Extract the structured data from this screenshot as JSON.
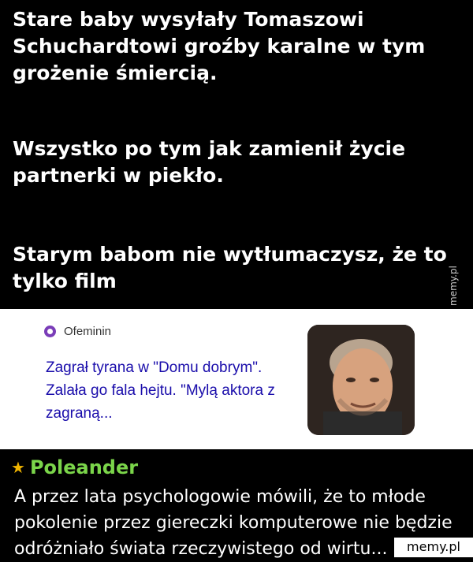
{
  "text_panel": {
    "paragraph_1": "Stare baby wysyłały Tomaszowi Schuchardtowi groźby karalne w tym grożenie śmiercią.",
    "paragraph_2": "Wszystko po tym jak zamienił życie partnerki w piekło.",
    "paragraph_3_line1": "Starym babom nie wytłumaczysz, że to",
    "paragraph_3_line2": "tylko film"
  },
  "article_card": {
    "source": "Ofeminin",
    "headline": "Zagrał tyrana w \"Domu dobrym\". Zalała go fala hejtu. \"Mylą aktora z zagraną...",
    "thumbnail_icon": "actor-portrait-icon"
  },
  "comment": {
    "author": "Poleander",
    "star_icon": "star-icon",
    "text": "A przez lata psychologowie mówili, że to młode pokolenie przez giereczki komputerowe nie będzie odróżniało świata rzeczywistego od wirtu..."
  },
  "watermarks": {
    "side": "memy.pl",
    "bottom": "memy.pl"
  },
  "colors": {
    "background": "#000000",
    "text_white": "#ffffff",
    "author_green": "#7bd54a",
    "star_gold": "#f0b400",
    "link_blue": "#1a0dab",
    "source_purple": "#7a3db8"
  }
}
